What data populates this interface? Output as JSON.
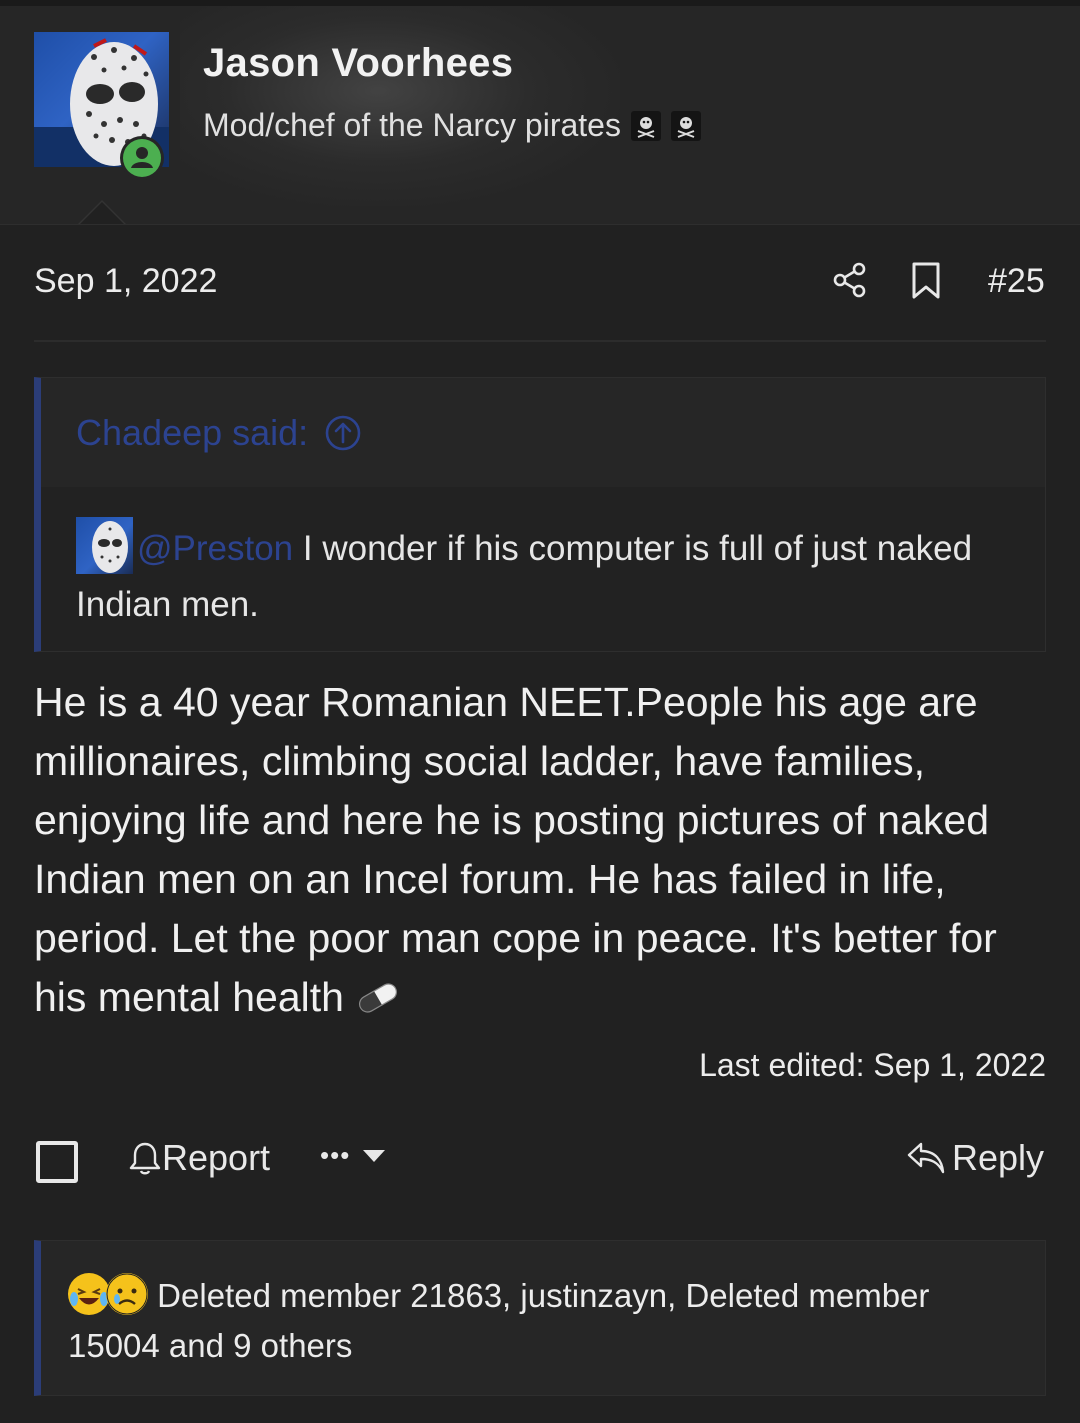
{
  "user": {
    "name": "Jason Voorhees",
    "title": "Mod/chef of the Narcy pirates",
    "avatar_icon": "hockey-mask-avatar",
    "status_icon": "online-user-icon",
    "flags": [
      "pirate-flag-icon",
      "pirate-flag-icon"
    ]
  },
  "post": {
    "date": "Sep 1, 2022",
    "number": "#25",
    "share_icon": "share-icon",
    "bookmark_icon": "bookmark-icon"
  },
  "quote": {
    "author_label": "Chadeep said:",
    "mention": "@Preston",
    "text": " I wonder if his computer is full of just naked Indian men."
  },
  "body": {
    "text": "He is a 40 year Romanian NEET.People his age are millionaires, climbing social ladder, have families, enjoying life and here he is posting pictures of naked Indian men on an Incel forum. He has failed in life, period. Let the poor man cope in peace. It's better for his mental health",
    "trailing_icon": "pill-icon",
    "last_edited": "Last edited: Sep 1, 2022"
  },
  "actions": {
    "report_label": "Report",
    "more_label": "•••",
    "reply_label": "Reply"
  },
  "reactions": {
    "icons": [
      "laughing-crying-emoji",
      "sad-emoji"
    ],
    "text": "Deleted member 21863, justinzayn, Deleted member 15004 and 9 others"
  },
  "colors": {
    "background": "#212121",
    "accent_blue": "#2c4390",
    "online_green": "#4caf50"
  }
}
